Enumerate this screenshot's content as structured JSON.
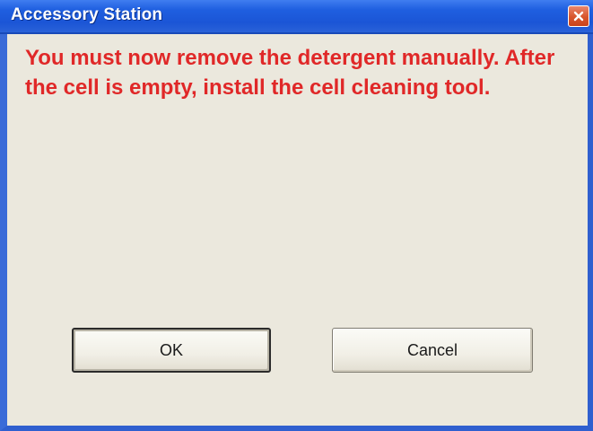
{
  "window": {
    "title": "Accessory Station",
    "close_icon": "close-icon"
  },
  "message": {
    "text": "You must now remove the detergent manually.  After the cell is empty, install the cell cleaning tool."
  },
  "buttons": {
    "ok_label": "OK",
    "cancel_label": "Cancel"
  },
  "colors": {
    "titlebar": "#1f5fe0",
    "message_text": "#e02828",
    "dialog_background": "#ebe8dd",
    "close_button": "#d8552d"
  }
}
